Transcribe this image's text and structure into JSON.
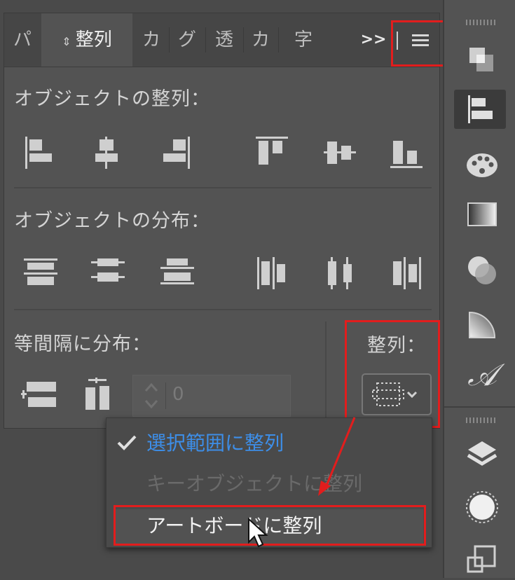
{
  "tabs": [
    {
      "label": "パ",
      "active": false
    },
    {
      "label": "整列",
      "active": true
    },
    {
      "label": "カ",
      "active": false
    },
    {
      "label": "グ",
      "active": false
    },
    {
      "label": "透",
      "active": false
    },
    {
      "label": "カ",
      "active": false
    },
    {
      "label": "字",
      "active": false
    }
  ],
  "overflow_label": ">>",
  "sections": {
    "align_objects": "オブジェクトの整列：",
    "distribute_objects": "オブジェクトの分布：",
    "distribute_spacing": "等間隔に分布：",
    "align_to": "整列："
  },
  "spacing_value": "0",
  "dropdown": {
    "items": [
      {
        "label": "選択範囲に整列",
        "checked": true,
        "enabled": true
      },
      {
        "label": "キーオブジェクトに整列",
        "checked": false,
        "enabled": false
      },
      {
        "label": "アートボードに整列",
        "checked": false,
        "enabled": true,
        "hovered": true
      }
    ]
  },
  "colors": {
    "highlight_red": "#e21d1d",
    "selected_blue": "#3d8ee8",
    "panel_bg": "#535353"
  }
}
